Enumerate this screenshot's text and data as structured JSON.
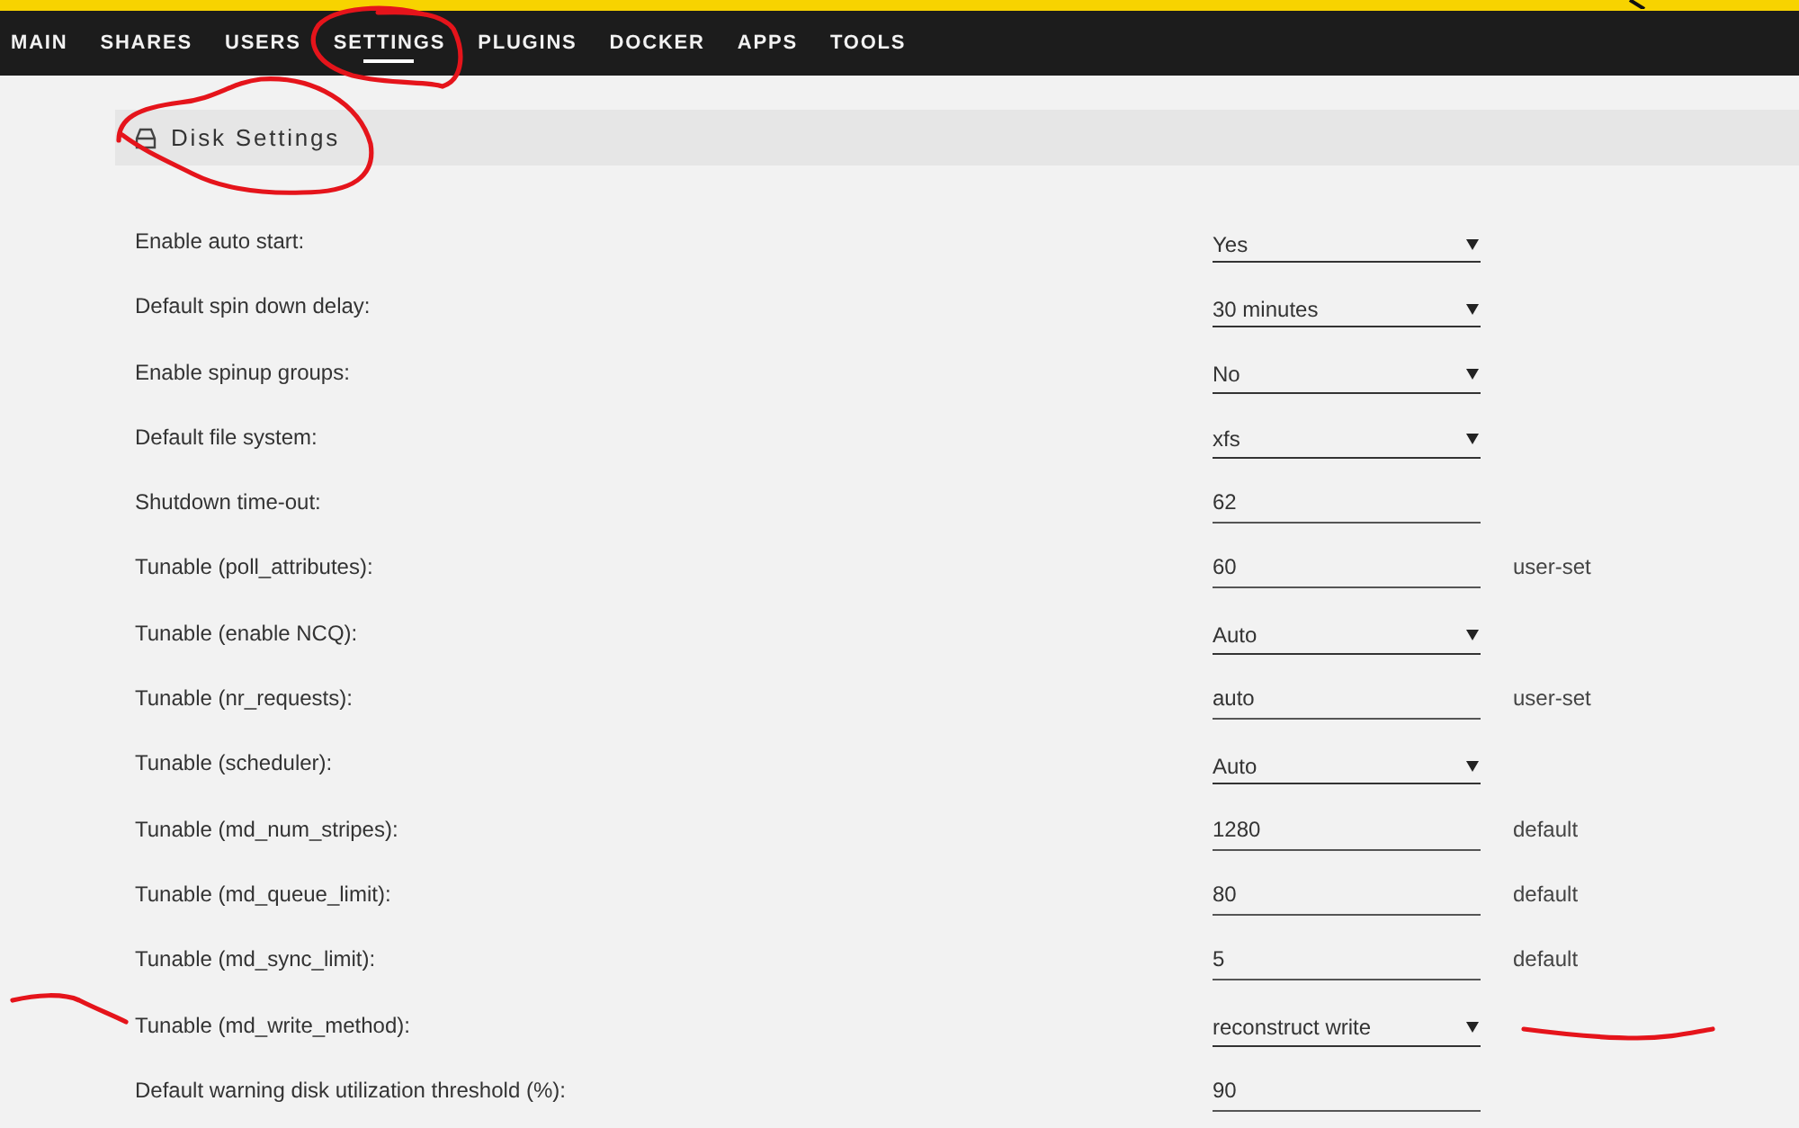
{
  "nav": {
    "items": [
      {
        "label": "MAIN",
        "selected": false
      },
      {
        "label": "SHARES",
        "selected": false
      },
      {
        "label": "USERS",
        "selected": false
      },
      {
        "label": "SETTINGS",
        "selected": true
      },
      {
        "label": "PLUGINS",
        "selected": false
      },
      {
        "label": "DOCKER",
        "selected": false
      },
      {
        "label": "APPS",
        "selected": false
      },
      {
        "label": "TOOLS",
        "selected": false
      }
    ]
  },
  "section": {
    "title": "Disk Settings"
  },
  "settings": [
    {
      "label": "Enable auto start:",
      "kind": "select",
      "value": "Yes"
    },
    {
      "label": "Default spin down delay:",
      "kind": "select",
      "value": "30 minutes"
    },
    {
      "label": "Enable spinup groups:",
      "kind": "select",
      "value": "No"
    },
    {
      "label": "Default file system:",
      "kind": "select",
      "value": "xfs"
    },
    {
      "label": "Shutdown time-out:",
      "kind": "text",
      "value": "62"
    },
    {
      "label": "Tunable (poll_attributes):",
      "kind": "text",
      "value": "60",
      "note": "user-set"
    },
    {
      "label": "Tunable (enable NCQ):",
      "kind": "select",
      "value": "Auto"
    },
    {
      "label": "Tunable (nr_requests):",
      "kind": "text",
      "value": "auto",
      "note": "user-set"
    },
    {
      "label": "Tunable (scheduler):",
      "kind": "select",
      "value": "Auto"
    },
    {
      "label": "Tunable (md_num_stripes):",
      "kind": "text",
      "value": "1280",
      "note": "default"
    },
    {
      "label": "Tunable (md_queue_limit):",
      "kind": "text",
      "value": "80",
      "note": "default"
    },
    {
      "label": "Tunable (md_sync_limit):",
      "kind": "text",
      "value": "5",
      "note": "default"
    },
    {
      "label": "Tunable (md_write_method):",
      "kind": "select",
      "value": "reconstruct write"
    },
    {
      "label": "Default warning disk utilization threshold (%):",
      "kind": "text",
      "value": "90"
    }
  ]
}
